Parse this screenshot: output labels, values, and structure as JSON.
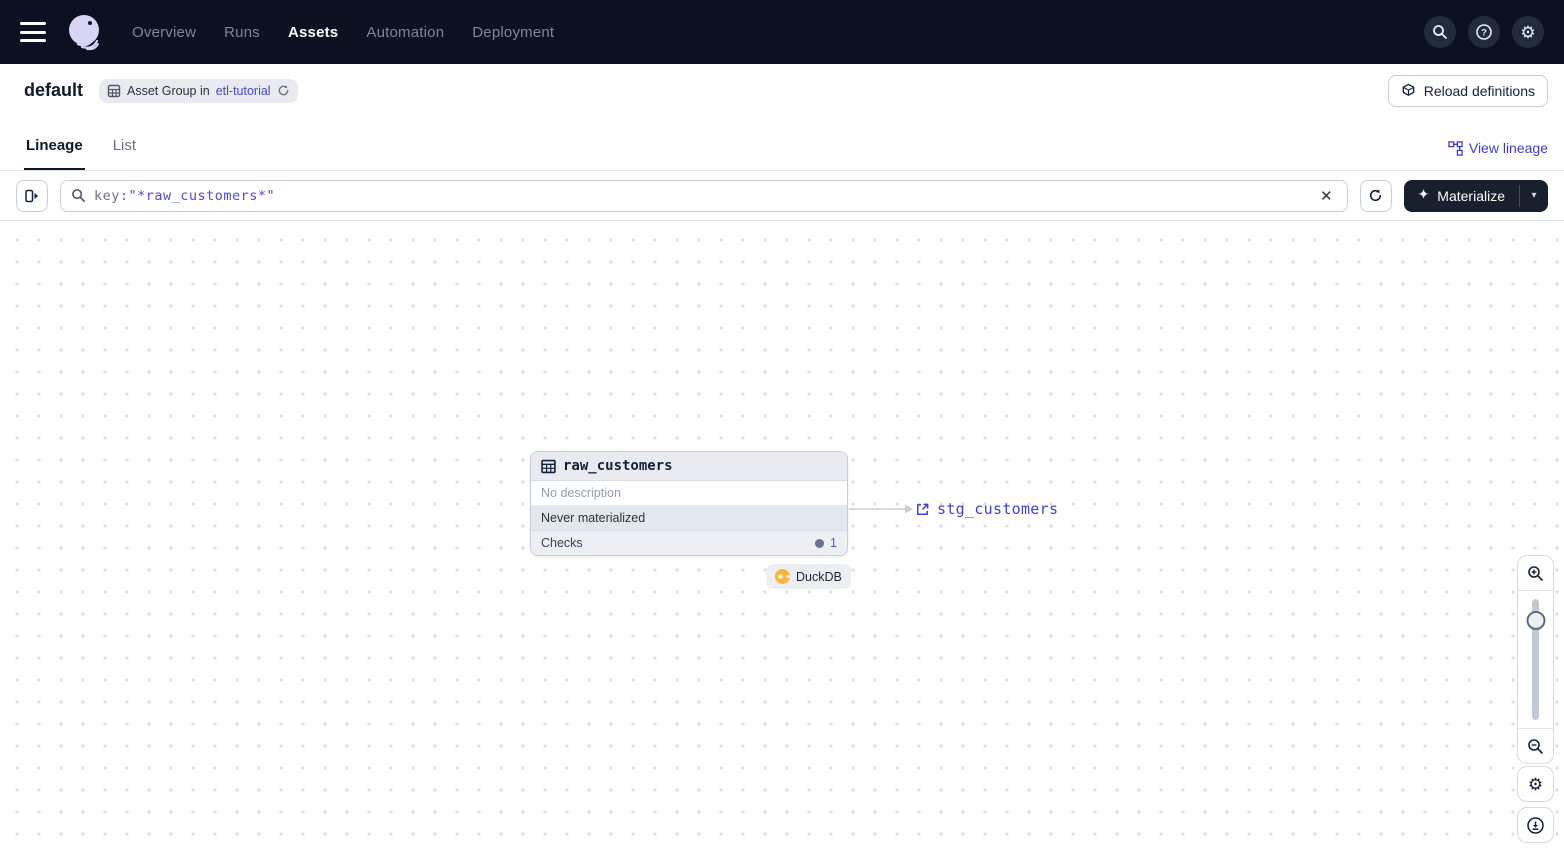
{
  "topnav": {
    "nav_items": [
      {
        "label": "Overview",
        "active": false
      },
      {
        "label": "Runs",
        "active": false
      },
      {
        "label": "Assets",
        "active": true
      },
      {
        "label": "Automation",
        "active": false
      },
      {
        "label": "Deployment",
        "active": false
      }
    ]
  },
  "header": {
    "title": "default",
    "badge_prefix": "Asset Group in",
    "badge_link": "etl-tutorial",
    "reload_button": "Reload definitions"
  },
  "tabs": {
    "lineage": "Lineage",
    "list": "List",
    "view_lineage": "View lineage"
  },
  "toolbar": {
    "filter_prefix": "key:",
    "filter_value": "\"*raw_customers*\"",
    "materialize_label": "Materialize"
  },
  "graph": {
    "node": {
      "name": "raw_customers",
      "description": "No description",
      "status": "Never materialized",
      "checks_label": "Checks",
      "checks_count": "1",
      "tag": "DuckDB"
    },
    "downstream_link": "stg_customers"
  },
  "icons": {
    "sparkles": "✦",
    "caret_down": "▾",
    "close": "✕",
    "gear": "⚙"
  },
  "colors": {
    "nav_bg": "#0b1120",
    "accent_link": "#4340cc",
    "filter_value": "#4f49d8",
    "materialize_bg": "#182030",
    "duckdb_yellow": "#f6b63c",
    "status_row_bg": "#e3e7ee"
  }
}
